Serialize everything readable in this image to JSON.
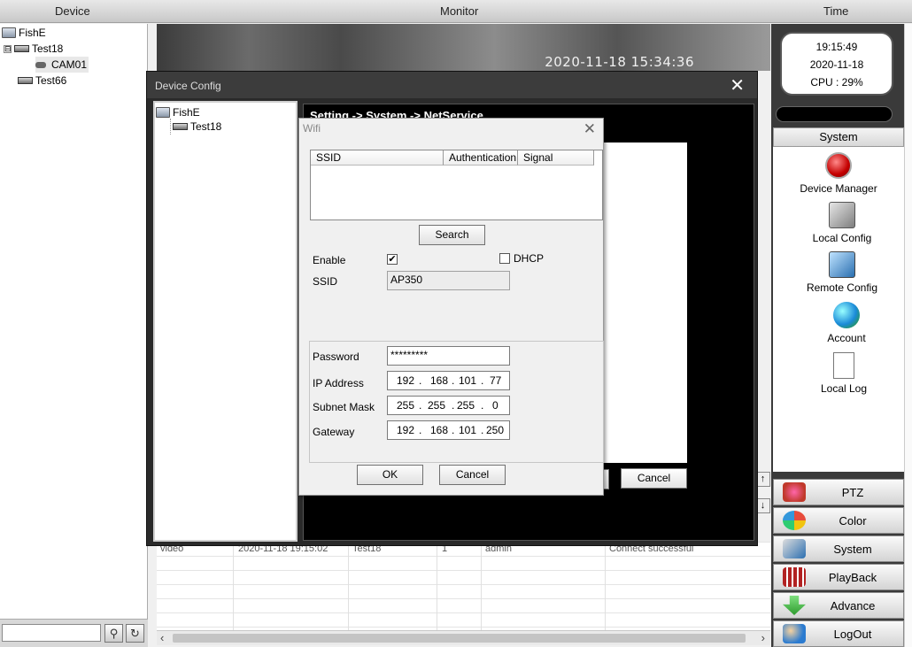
{
  "header": {
    "device": "Device",
    "monitor": "Monitor",
    "time": "Time"
  },
  "tree": [
    {
      "label": "FishE",
      "icon": "computer-icon"
    },
    {
      "label": "Test18",
      "icon": "dvr-icon",
      "expander": "⊟"
    },
    {
      "label": "CAM01",
      "icon": "camera-icon"
    },
    {
      "label": "Test66",
      "icon": "dvr-icon"
    }
  ],
  "video": {
    "timestamp": "2020-11-18 15:34:36"
  },
  "clock": {
    "time": "19:15:49",
    "date": "2020-11-18",
    "cpu": "CPU : 29%"
  },
  "system_panel": {
    "header": "System",
    "items": [
      {
        "label": "Device Manager",
        "icon": "red-button-icon"
      },
      {
        "label": "Local Config",
        "icon": "local-config-icon"
      },
      {
        "label": "Remote Config",
        "icon": "remote-config-icon"
      },
      {
        "label": "Account",
        "icon": "users-icon"
      },
      {
        "label": "Local Log",
        "icon": "document-icon"
      }
    ]
  },
  "menu": [
    {
      "label": "PTZ",
      "icon": "ptz-icon",
      "color": "#c0392b"
    },
    {
      "label": "Color",
      "icon": "color-icon",
      "color": "#e67e22"
    },
    {
      "label": "System",
      "icon": "system-icon",
      "color": "#2c6fb0"
    },
    {
      "label": "PlayBack",
      "icon": "playback-icon",
      "color": "#b22222"
    },
    {
      "label": "Advance",
      "icon": "advance-icon",
      "color": "#2e9b2e"
    },
    {
      "label": "LogOut",
      "icon": "logout-icon",
      "color": "#2b7bd0"
    }
  ],
  "log": {
    "row": [
      "video",
      "2020-11-18 19:15:02",
      "Test18",
      "1",
      "admin",
      "Connect successful"
    ]
  },
  "device_config": {
    "title": "Device Config",
    "breadcrumb": "Setting -> System -> NetService",
    "tree": [
      "FishE",
      "Test18"
    ],
    "cancel_label": "Cancel"
  },
  "wifi": {
    "title": "Wifi",
    "columns": [
      "SSID",
      "Authentication",
      "Signal"
    ],
    "search_label": "Search",
    "enable_label": "Enable",
    "enable_checked": true,
    "dhcp_label": "DHCP",
    "dhcp_checked": false,
    "ssid_label": "SSID",
    "ssid_value": "AP350",
    "password_label": "Password",
    "password_value": "*********",
    "ip_label": "IP Address",
    "ip": [
      "192",
      "168",
      "101",
      "77"
    ],
    "mask_label": "Subnet Mask",
    "mask": [
      "255",
      "255",
      "255",
      "0"
    ],
    "gateway_label": "Gateway",
    "gateway": [
      "192",
      "168",
      "101",
      "250"
    ],
    "ok_label": "OK",
    "cancel_label": "Cancel"
  },
  "colors": {
    "panel_dark": "#3a3a3a",
    "window_black": "#000000",
    "dialog": "#f0f0f0"
  }
}
